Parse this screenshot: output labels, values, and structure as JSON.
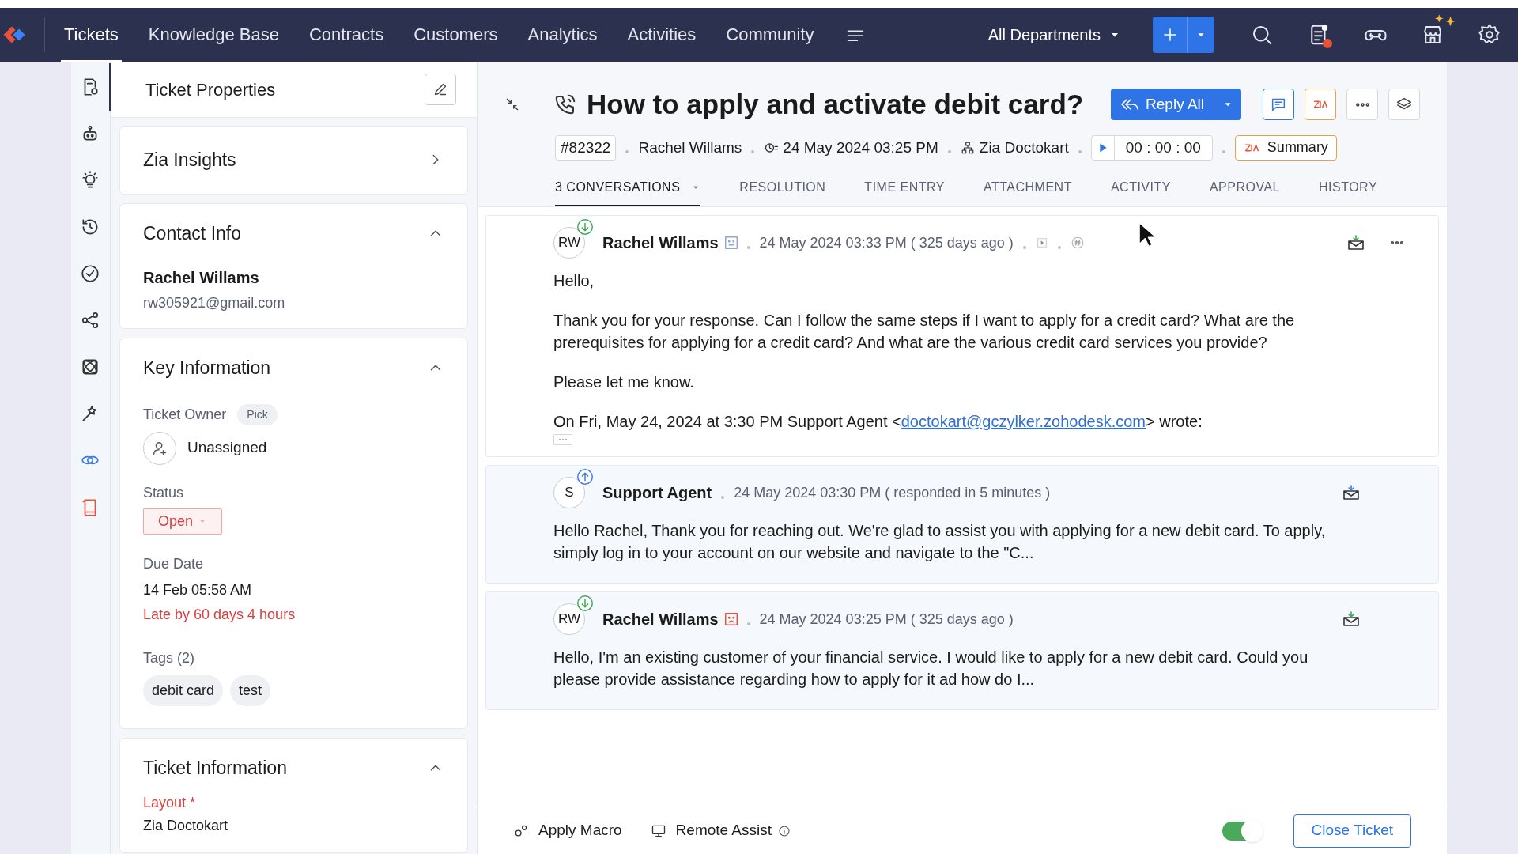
{
  "nav": {
    "tabs": [
      {
        "label": "Tickets",
        "selected": true
      },
      {
        "label": "Knowledge Base",
        "selected": false
      },
      {
        "label": "Contracts",
        "selected": false
      },
      {
        "label": "Customers",
        "selected": false
      },
      {
        "label": "Analytics",
        "selected": false
      },
      {
        "label": "Activities",
        "selected": false
      },
      {
        "label": "Community",
        "selected": false
      }
    ],
    "department": "All Departments",
    "notification": true
  },
  "rail": [
    {
      "kind": "properties",
      "selected": true
    },
    {
      "kind": "bot",
      "selected": false
    },
    {
      "kind": "idea",
      "selected": false
    },
    {
      "kind": "history",
      "selected": false
    },
    {
      "kind": "check",
      "selected": false
    },
    {
      "kind": "share",
      "selected": false
    },
    {
      "kind": "atom",
      "selected": false
    },
    {
      "kind": "magic",
      "selected": false
    },
    {
      "kind": "link",
      "selected": false
    },
    {
      "kind": "book",
      "selected": false
    }
  ],
  "panel": {
    "title": "Ticket Properties",
    "zia_insights": {
      "title": "Zia Insights"
    },
    "contact_info": {
      "title": "Contact Info",
      "expanded": true,
      "name": "Rachel Willams",
      "email": "rw305921@gmail.com"
    },
    "key_information": {
      "title": "Key Information",
      "expanded": true,
      "owner_label": "Ticket Owner",
      "pick": "Pick",
      "owner": "Unassigned",
      "status_label": "Status",
      "status": "Open",
      "due_label": "Due Date",
      "due": "14 Feb 05:58 AM",
      "overdue": "Late by 60 days 4 hours",
      "tags_label": "Tags (2)",
      "tags": [
        "debit card",
        "test"
      ]
    },
    "ticket_information": {
      "title": "Ticket Information",
      "expanded": true,
      "layout_label": "Layout *",
      "layout": "Zia Doctokart"
    }
  },
  "ticket": {
    "title": "How to apply and activate debit card?",
    "reply": "Reply All",
    "number": "#82322",
    "contact": "Rachel Willams",
    "created": "24 May 2024 03:25 PM",
    "department": "Zia Doctokart",
    "timer": "00 : 00 : 00",
    "summary": "Summary"
  },
  "tabs": [
    {
      "label": "3 CONVERSATIONS",
      "selected": true
    },
    {
      "label": "RESOLUTION",
      "selected": false
    },
    {
      "label": "TIME ENTRY",
      "selected": false
    },
    {
      "label": "ATTACHMENT",
      "selected": false
    },
    {
      "label": "ACTIVITY",
      "selected": false
    },
    {
      "label": "APPROVAL",
      "selected": false
    },
    {
      "label": "HISTORY",
      "selected": false
    }
  ],
  "conversations": [
    {
      "initials": "RW",
      "name": "Rachel Willams",
      "kind": "incoming",
      "unhappy": false,
      "time": "24 May 2024 03:33 PM ( 325 days ago )",
      "expanded": true,
      "body": [
        {
          "kind": "text",
          "text": "Hello,"
        },
        {
          "kind": "text",
          "text": "Thank you for your response. Can I follow the same steps if I want to apply for a credit card? What are the prerequisites for applying for a credit card? And what are the various credit card services you provide?"
        },
        {
          "kind": "text",
          "text": "Please let me know."
        },
        {
          "kind": "quote",
          "before": "On Fri, May 24, 2024 at 3:30 PM Support Agent <",
          "link": "doctokart@gczylker.zohodesk.com",
          "after": "> wrote:"
        }
      ]
    },
    {
      "initials": "S",
      "name": "Support Agent",
      "kind": "outgoing",
      "time": "24 May 2024 03:30 PM ( responded in 5 minutes )",
      "expanded": false,
      "body": [
        {
          "kind": "text",
          "text": "Hello Rachel, Thank you for reaching out. We're glad to assist you with applying for a new debit card. To apply, simply log in to your account on our website and navigate to the \"C..."
        }
      ]
    },
    {
      "initials": "RW",
      "name": "Rachel Willams",
      "kind": "incoming",
      "unhappy": true,
      "time": "24 May 2024 03:25 PM ( 325 days ago )",
      "expanded": false,
      "body": [
        {
          "kind": "text",
          "text": "Hello, I'm an existing customer of your financial service. I would like to apply for a new debit card. Could you please provide assistance regarding how to apply for it ad how do I..."
        }
      ]
    }
  ],
  "footer": {
    "macro": "Apply Macro",
    "remote": "Remote Assist",
    "toggle_on": true,
    "close": "Close Ticket"
  }
}
